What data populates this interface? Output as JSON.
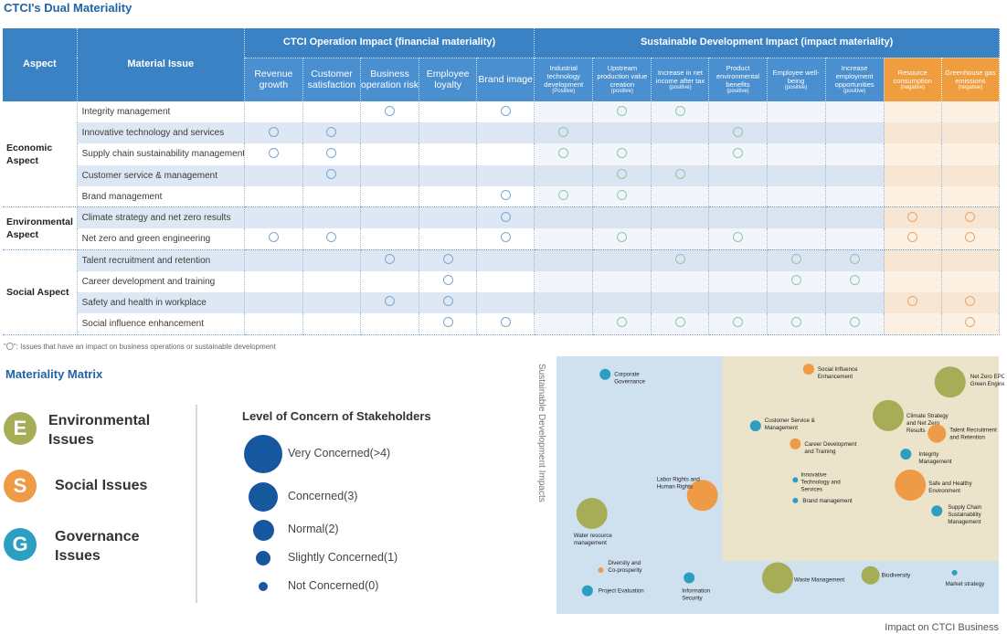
{
  "page_title": "CTCI's Dual Materiality",
  "table": {
    "aspect_header": "Aspect",
    "issue_header": "Material Issue",
    "group_financial": "CTCI Operation Impact (financial materiality)",
    "group_impact": "Sustainable Development Impact (impact materiality)",
    "financial_columns": [
      "Revenue growth",
      "Customer satisfaction",
      "Business operation risk",
      "Employee loyalty",
      "Brand image"
    ],
    "impact_columns": [
      {
        "label": "Industrial technology development",
        "tag": "(Positive)"
      },
      {
        "label": "Upstream production value creation",
        "tag": "(positive)"
      },
      {
        "label": "Increase in net income after tax",
        "tag": "(positive)"
      },
      {
        "label": "Product environmental benefits",
        "tag": "(positive)"
      },
      {
        "label": "Employee well-being",
        "tag": "(positive)"
      },
      {
        "label": "Increase employment opportunities",
        "tag": "(positive)"
      },
      {
        "label": "Resource consumption",
        "tag": "(negative)"
      },
      {
        "label": "Greenhouse gas emissions",
        "tag": "(negative)"
      }
    ],
    "aspects": [
      "Economic Aspect",
      "Environmental Aspect",
      "Social Aspect"
    ],
    "rows": [
      {
        "issue": "Integrity management",
        "marks": [
          0,
          0,
          1,
          0,
          1,
          0,
          1,
          1,
          0,
          0,
          0,
          0,
          0
        ]
      },
      {
        "issue": "Innovative technology and services",
        "marks": [
          1,
          1,
          0,
          0,
          0,
          1,
          0,
          0,
          1,
          0,
          0,
          0,
          0
        ]
      },
      {
        "issue": "Supply chain sustainability management",
        "marks": [
          1,
          1,
          0,
          0,
          0,
          1,
          1,
          0,
          1,
          0,
          0,
          0,
          0
        ]
      },
      {
        "issue": "Customer service & management",
        "marks": [
          0,
          1,
          0,
          0,
          0,
          0,
          1,
          1,
          0,
          0,
          0,
          0,
          0
        ]
      },
      {
        "issue": "Brand management",
        "marks": [
          0,
          0,
          0,
          0,
          1,
          1,
          1,
          0,
          0,
          0,
          0,
          0,
          0
        ]
      },
      {
        "issue": "Climate strategy and net zero results",
        "marks": [
          0,
          0,
          0,
          0,
          1,
          0,
          0,
          0,
          0,
          0,
          0,
          1,
          1
        ]
      },
      {
        "issue": "Net zero and green engineering",
        "marks": [
          1,
          1,
          0,
          0,
          1,
          0,
          1,
          0,
          1,
          0,
          0,
          1,
          1
        ]
      },
      {
        "issue": "Talent recruitment and retention",
        "marks": [
          0,
          0,
          1,
          1,
          0,
          0,
          0,
          1,
          0,
          1,
          1,
          0,
          0
        ]
      },
      {
        "issue": "Career development and training",
        "marks": [
          0,
          0,
          0,
          1,
          0,
          0,
          0,
          0,
          0,
          1,
          1,
          0,
          0
        ]
      },
      {
        "issue": "Safety and health in workplace",
        "marks": [
          0,
          0,
          1,
          1,
          0,
          0,
          0,
          0,
          0,
          0,
          0,
          1,
          1
        ]
      },
      {
        "issue": "Social influence enhancement",
        "marks": [
          0,
          0,
          0,
          1,
          1,
          0,
          1,
          1,
          1,
          1,
          1,
          0,
          1
        ]
      }
    ],
    "footnote": "\"〇\": Issues that have an impact on business operations or sustainable development"
  },
  "matrix_title": "Materiality Matrix",
  "categories": [
    {
      "letter": "E",
      "label": "Environmental Issues",
      "color": "#a7ad56"
    },
    {
      "letter": "S",
      "label": "Social Issues",
      "color": "#ee9a46"
    },
    {
      "letter": "G",
      "label": "Governance Issues",
      "color": "#2b9ec2"
    }
  ],
  "concern_title": "Level of Concern of Stakeholders",
  "concern_levels": [
    "Very Concerned(>4)",
    "Concerned(3)",
    "Normal(2)",
    "Slightly Concerned(1)",
    "Not Concerned(0)"
  ],
  "colors": {
    "primary": "#1f63a6",
    "header": "#3a82c4",
    "negative_header": "#ef9d3f",
    "legend_dot": "#1657a0",
    "quadrant_blue": "#cfe0ef",
    "quadrant_beige": "#ebe3ca"
  },
  "chart_data": {
    "type": "scatter",
    "xlabel": "Impact on CTCI Business",
    "ylabel": "Sustainable Development Impacts",
    "points": [
      {
        "label": "Corporate Governance",
        "x": 1.1,
        "y": 9.3,
        "category": "G",
        "concern": 1
      },
      {
        "label": "Social Influence Enhancement",
        "x": 5.7,
        "y": 9.5,
        "category": "S",
        "concern": 1
      },
      {
        "label": "Net Zero EPC and Green Engineering",
        "x": 8.9,
        "y": 9.0,
        "category": "E",
        "concern": 4
      },
      {
        "label": "Climate Strategy and Net Zero Results",
        "x": 7.5,
        "y": 7.7,
        "category": "E",
        "concern": 4
      },
      {
        "label": "Customer Service & Management",
        "x": 4.5,
        "y": 7.3,
        "category": "G",
        "concern": 1
      },
      {
        "label": "Talent Recruitment and Retention",
        "x": 8.6,
        "y": 7.0,
        "category": "S",
        "concern": 2
      },
      {
        "label": "Career Development and Training",
        "x": 5.4,
        "y": 6.6,
        "category": "S",
        "concern": 1
      },
      {
        "label": "Integrity Management",
        "x": 7.9,
        "y": 6.2,
        "category": "G",
        "concern": 1
      },
      {
        "label": "Innovative Technology and Services",
        "x": 5.4,
        "y": 5.2,
        "category": "G",
        "concern": 0
      },
      {
        "label": "Labor Rights and Human Rights",
        "x": 3.3,
        "y": 4.6,
        "category": "S",
        "concern": 4
      },
      {
        "label": "Safe and Healthy Environment",
        "x": 8.0,
        "y": 5.0,
        "category": "S",
        "concern": 4
      },
      {
        "label": "Brand management",
        "x": 5.4,
        "y": 4.4,
        "category": "G",
        "concern": 0
      },
      {
        "label": "Supply Chain Sustainability Management",
        "x": 8.6,
        "y": 4.0,
        "category": "G",
        "concern": 1
      },
      {
        "label": "Water resource management",
        "x": 0.8,
        "y": 3.9,
        "category": "E",
        "concern": 4
      },
      {
        "label": "Diversity and Co-prosperity",
        "x": 1.0,
        "y": 1.7,
        "category": "S",
        "concern": 0
      },
      {
        "label": "Information Security",
        "x": 3.0,
        "y": 1.4,
        "category": "G",
        "concern": 1
      },
      {
        "label": "Waste Management",
        "x": 5.0,
        "y": 1.4,
        "category": "E",
        "concern": 4
      },
      {
        "label": "Biodiversity",
        "x": 7.1,
        "y": 1.5,
        "category": "E",
        "concern": 2
      },
      {
        "label": "Market strategy",
        "x": 9.0,
        "y": 1.6,
        "category": "G",
        "concern": 0
      },
      {
        "label": "Project Evaluation",
        "x": 0.7,
        "y": 0.9,
        "category": "G",
        "concern": 1
      }
    ]
  }
}
